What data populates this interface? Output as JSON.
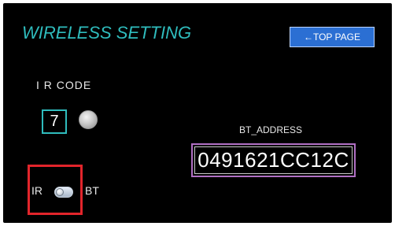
{
  "screen": {
    "title": "WIRELESS SETTING",
    "top_page_button": "←TOP PAGE"
  },
  "ir_code": {
    "label": "I R CODE",
    "value": "7"
  },
  "bt_address": {
    "label": "BT_ADDRESS",
    "value": "0491621CC12C"
  },
  "mode_toggle": {
    "left_label": "IR",
    "right_label": "BT"
  },
  "colors": {
    "panel_background": "#000000",
    "title_accent": "#2fbcbd",
    "button_blue": "#2b6fd3",
    "highlight_red": "#e2252b",
    "address_border": "#b06fc3"
  },
  "icons": {
    "ir_code_status": "gray-circle-icon",
    "mode_toggle": "toggle-switch-icon"
  }
}
